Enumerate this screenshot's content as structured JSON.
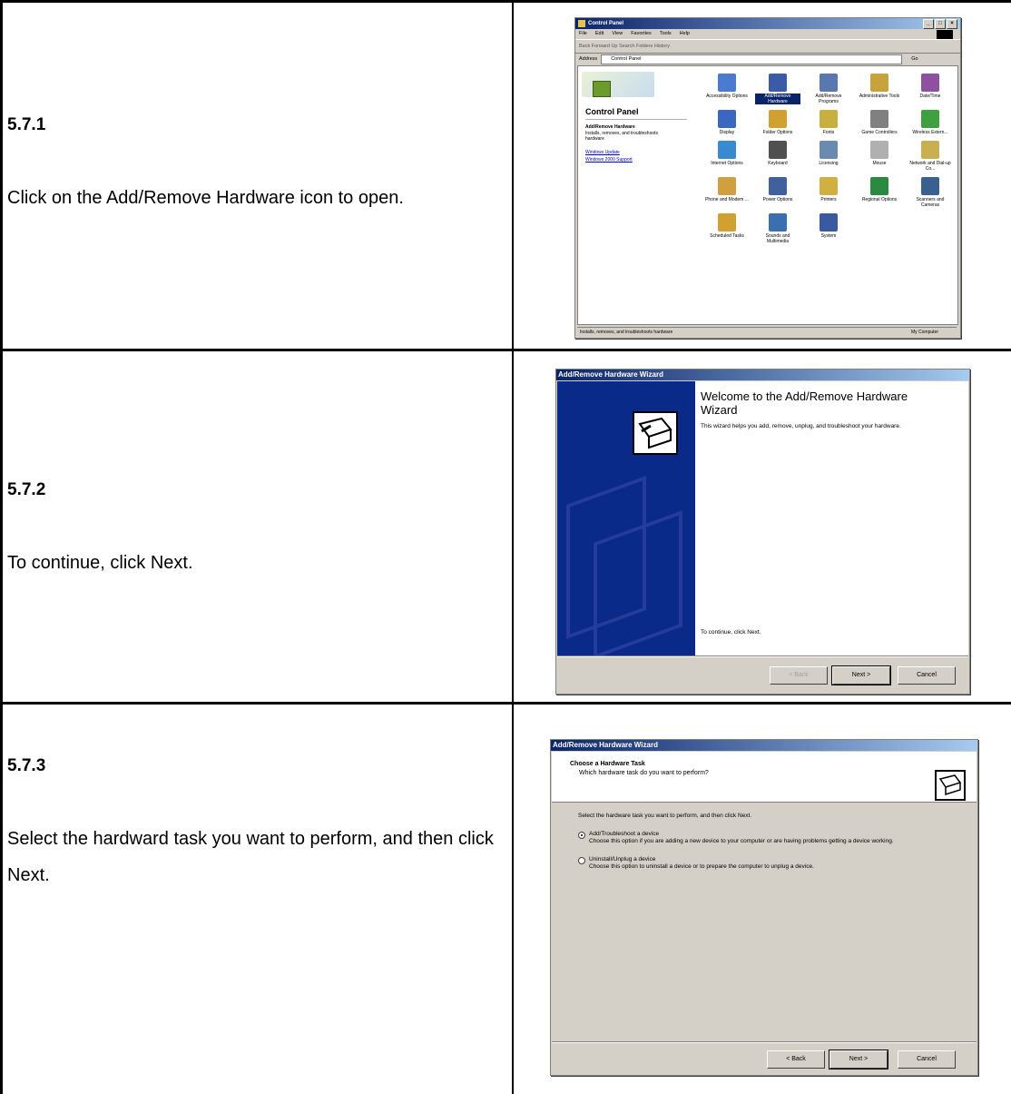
{
  "steps": [
    {
      "number": "5.7.1",
      "text": "Click on the Add/Remove Hardware icon to open."
    },
    {
      "number": "5.7.2",
      "text": "To continue, click Next."
    },
    {
      "number": "5.7.3",
      "text": "Select the hardward task you want to perform, and then click Next."
    }
  ],
  "control_panel": {
    "title": "Control Panel",
    "menu": [
      "File",
      "Edit",
      "View",
      "Favorites",
      "Tools",
      "Help"
    ],
    "toolbar": "Back  Forward  Up  Search  Folders  History",
    "address_label": "Address",
    "address_value": "Control Panel",
    "go_label": "Go",
    "side_title": "Control Panel",
    "selected_title": "Add/Remove Hardware",
    "selected_desc": "Installs, removes, and troubleshoots hardware",
    "links": [
      "Windows Update",
      "Windows 2000 Support"
    ],
    "icons": [
      {
        "label": "Accessibility Options",
        "color": "#4a7bd0"
      },
      {
        "label": "Add/Remove Hardware",
        "color": "#3b5aa8",
        "selected": true
      },
      {
        "label": "Add/Remove Programs",
        "color": "#5a78b0"
      },
      {
        "label": "Administrative Tools",
        "color": "#c8a23a"
      },
      {
        "label": "Date/Time",
        "color": "#9050a0"
      },
      {
        "label": "Display",
        "color": "#3a68c0"
      },
      {
        "label": "Folder Options",
        "color": "#d0a030"
      },
      {
        "label": "Fonts",
        "color": "#c8b040"
      },
      {
        "label": "Game Controllers",
        "color": "#808080"
      },
      {
        "label": "Wireless Extern...",
        "color": "#40a040"
      },
      {
        "label": "Internet Options",
        "color": "#3a8ad0"
      },
      {
        "label": "Keyboard",
        "color": "#505050"
      },
      {
        "label": "Licensing",
        "color": "#6a8ab0"
      },
      {
        "label": "Mouse",
        "color": "#b0b0b0"
      },
      {
        "label": "Network and Dial-up Co...",
        "color": "#c8b050"
      },
      {
        "label": "Phone and Modem ...",
        "color": "#d0a040"
      },
      {
        "label": "Power Options",
        "color": "#4060a0"
      },
      {
        "label": "Printers",
        "color": "#d0b040"
      },
      {
        "label": "Regional Options",
        "color": "#2a8a40"
      },
      {
        "label": "Scanners and Cameras",
        "color": "#3a6090"
      },
      {
        "label": "Scheduled Tasks",
        "color": "#d0a030"
      },
      {
        "label": "Sounds and Multimedia",
        "color": "#3a70b0"
      },
      {
        "label": "System",
        "color": "#3a5aa0"
      }
    ],
    "status_left": "Installs, removes, and troubleshoots hardware",
    "status_right": "My Computer"
  },
  "wizard_welcome": {
    "title": "Add/Remove Hardware Wizard",
    "heading": "Welcome to the Add/Remove Hardware Wizard",
    "body": "This wizard helps you add, remove, unplug, and troubleshoot your hardware.",
    "continue": "To continue, click Next.",
    "back": "< Back",
    "next": "Next >",
    "cancel": "Cancel"
  },
  "wizard_task": {
    "title": "Add/Remove Hardware Wizard",
    "heading": "Choose a Hardware Task",
    "subheading": "Which hardware task do you want to perform?",
    "instruction": "Select the hardware task you want to perform, and then click Next.",
    "options": [
      {
        "label": "Add/Troubleshoot a device",
        "desc": "Choose this option if you are adding a new device to your computer or are having problems getting a device working.",
        "selected": true
      },
      {
        "label": "Uninstall/Unplug a device",
        "desc": "Choose this option to uninstall a device or to prepare the computer to unplug a device.",
        "selected": false
      }
    ],
    "back": "< Back",
    "next": "Next >",
    "cancel": "Cancel"
  }
}
